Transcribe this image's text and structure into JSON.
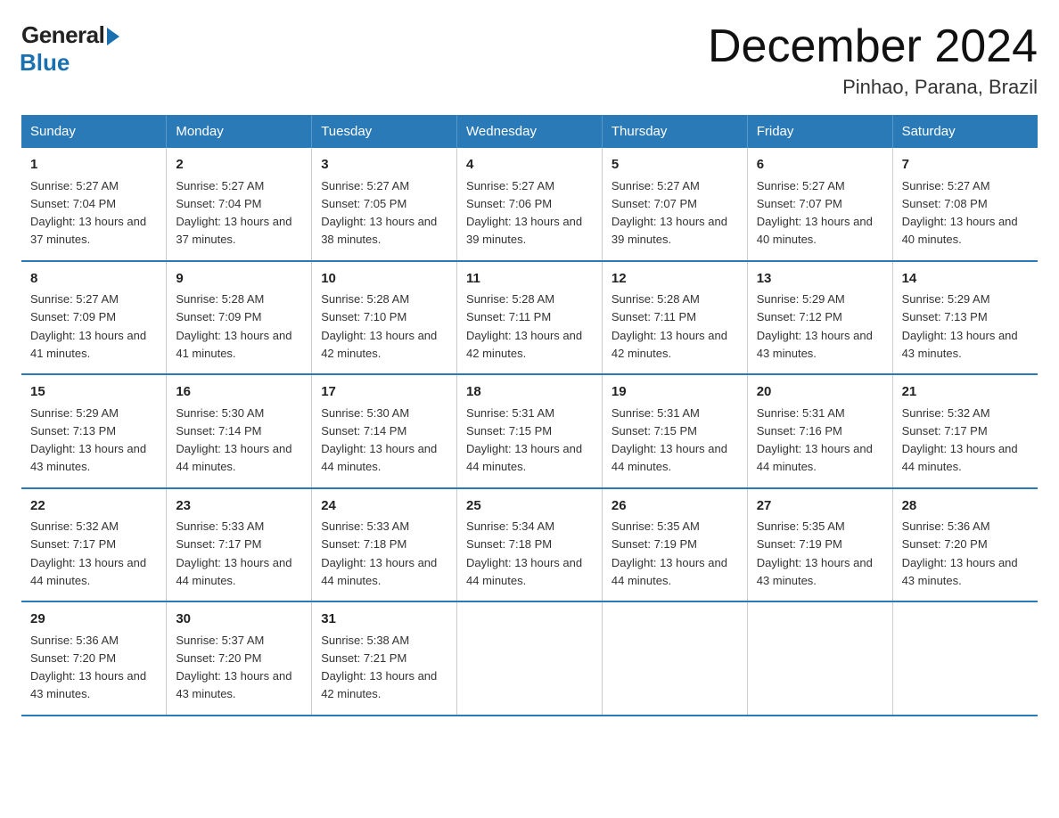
{
  "logo": {
    "general": "General",
    "blue": "Blue"
  },
  "title": "December 2024",
  "subtitle": "Pinhao, Parana, Brazil",
  "weekdays": [
    "Sunday",
    "Monday",
    "Tuesday",
    "Wednesday",
    "Thursday",
    "Friday",
    "Saturday"
  ],
  "weeks": [
    [
      {
        "day": "1",
        "sunrise": "5:27 AM",
        "sunset": "7:04 PM",
        "daylight": "13 hours and 37 minutes."
      },
      {
        "day": "2",
        "sunrise": "5:27 AM",
        "sunset": "7:04 PM",
        "daylight": "13 hours and 37 minutes."
      },
      {
        "day": "3",
        "sunrise": "5:27 AM",
        "sunset": "7:05 PM",
        "daylight": "13 hours and 38 minutes."
      },
      {
        "day": "4",
        "sunrise": "5:27 AM",
        "sunset": "7:06 PM",
        "daylight": "13 hours and 39 minutes."
      },
      {
        "day": "5",
        "sunrise": "5:27 AM",
        "sunset": "7:07 PM",
        "daylight": "13 hours and 39 minutes."
      },
      {
        "day": "6",
        "sunrise": "5:27 AM",
        "sunset": "7:07 PM",
        "daylight": "13 hours and 40 minutes."
      },
      {
        "day": "7",
        "sunrise": "5:27 AM",
        "sunset": "7:08 PM",
        "daylight": "13 hours and 40 minutes."
      }
    ],
    [
      {
        "day": "8",
        "sunrise": "5:27 AM",
        "sunset": "7:09 PM",
        "daylight": "13 hours and 41 minutes."
      },
      {
        "day": "9",
        "sunrise": "5:28 AM",
        "sunset": "7:09 PM",
        "daylight": "13 hours and 41 minutes."
      },
      {
        "day": "10",
        "sunrise": "5:28 AM",
        "sunset": "7:10 PM",
        "daylight": "13 hours and 42 minutes."
      },
      {
        "day": "11",
        "sunrise": "5:28 AM",
        "sunset": "7:11 PM",
        "daylight": "13 hours and 42 minutes."
      },
      {
        "day": "12",
        "sunrise": "5:28 AM",
        "sunset": "7:11 PM",
        "daylight": "13 hours and 42 minutes."
      },
      {
        "day": "13",
        "sunrise": "5:29 AM",
        "sunset": "7:12 PM",
        "daylight": "13 hours and 43 minutes."
      },
      {
        "day": "14",
        "sunrise": "5:29 AM",
        "sunset": "7:13 PM",
        "daylight": "13 hours and 43 minutes."
      }
    ],
    [
      {
        "day": "15",
        "sunrise": "5:29 AM",
        "sunset": "7:13 PM",
        "daylight": "13 hours and 43 minutes."
      },
      {
        "day": "16",
        "sunrise": "5:30 AM",
        "sunset": "7:14 PM",
        "daylight": "13 hours and 44 minutes."
      },
      {
        "day": "17",
        "sunrise": "5:30 AM",
        "sunset": "7:14 PM",
        "daylight": "13 hours and 44 minutes."
      },
      {
        "day": "18",
        "sunrise": "5:31 AM",
        "sunset": "7:15 PM",
        "daylight": "13 hours and 44 minutes."
      },
      {
        "day": "19",
        "sunrise": "5:31 AM",
        "sunset": "7:15 PM",
        "daylight": "13 hours and 44 minutes."
      },
      {
        "day": "20",
        "sunrise": "5:31 AM",
        "sunset": "7:16 PM",
        "daylight": "13 hours and 44 minutes."
      },
      {
        "day": "21",
        "sunrise": "5:32 AM",
        "sunset": "7:17 PM",
        "daylight": "13 hours and 44 minutes."
      }
    ],
    [
      {
        "day": "22",
        "sunrise": "5:32 AM",
        "sunset": "7:17 PM",
        "daylight": "13 hours and 44 minutes."
      },
      {
        "day": "23",
        "sunrise": "5:33 AM",
        "sunset": "7:17 PM",
        "daylight": "13 hours and 44 minutes."
      },
      {
        "day": "24",
        "sunrise": "5:33 AM",
        "sunset": "7:18 PM",
        "daylight": "13 hours and 44 minutes."
      },
      {
        "day": "25",
        "sunrise": "5:34 AM",
        "sunset": "7:18 PM",
        "daylight": "13 hours and 44 minutes."
      },
      {
        "day": "26",
        "sunrise": "5:35 AM",
        "sunset": "7:19 PM",
        "daylight": "13 hours and 44 minutes."
      },
      {
        "day": "27",
        "sunrise": "5:35 AM",
        "sunset": "7:19 PM",
        "daylight": "13 hours and 43 minutes."
      },
      {
        "day": "28",
        "sunrise": "5:36 AM",
        "sunset": "7:20 PM",
        "daylight": "13 hours and 43 minutes."
      }
    ],
    [
      {
        "day": "29",
        "sunrise": "5:36 AM",
        "sunset": "7:20 PM",
        "daylight": "13 hours and 43 minutes."
      },
      {
        "day": "30",
        "sunrise": "5:37 AM",
        "sunset": "7:20 PM",
        "daylight": "13 hours and 43 minutes."
      },
      {
        "day": "31",
        "sunrise": "5:38 AM",
        "sunset": "7:21 PM",
        "daylight": "13 hours and 42 minutes."
      },
      {
        "day": "",
        "sunrise": "",
        "sunset": "",
        "daylight": ""
      },
      {
        "day": "",
        "sunrise": "",
        "sunset": "",
        "daylight": ""
      },
      {
        "day": "",
        "sunrise": "",
        "sunset": "",
        "daylight": ""
      },
      {
        "day": "",
        "sunrise": "",
        "sunset": "",
        "daylight": ""
      }
    ]
  ]
}
